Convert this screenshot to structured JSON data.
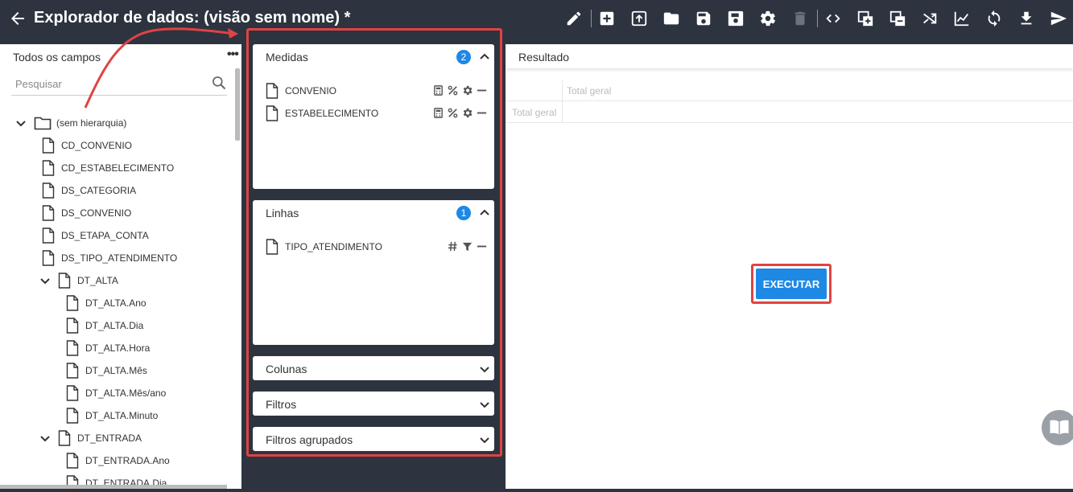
{
  "header": {
    "title": "Explorador de dados: (visão sem nome) *"
  },
  "toolbar": [
    {
      "name": "edit-icon"
    },
    {
      "name": "add-icon"
    },
    {
      "name": "upload-icon"
    },
    {
      "name": "folder-icon"
    },
    {
      "name": "save-icon"
    },
    {
      "name": "save-as-icon"
    },
    {
      "name": "settings-icon"
    },
    {
      "name": "delete-icon"
    },
    {
      "name": "code-icon"
    },
    {
      "name": "add-copy-icon"
    },
    {
      "name": "remove-copy-icon"
    },
    {
      "name": "shuffle-icon"
    },
    {
      "name": "chart-icon"
    },
    {
      "name": "refresh-icon"
    },
    {
      "name": "download-icon"
    },
    {
      "name": "send-icon"
    }
  ],
  "fields_panel": {
    "title": "Todos os campos",
    "more": "•••",
    "search_placeholder": "Pesquisar",
    "tree": [
      {
        "label": "(sem hierarquia)",
        "type": "folder"
      },
      {
        "label": "CD_CONVENIO",
        "type": "file"
      },
      {
        "label": "CD_ESTABELECIMENTO",
        "type": "file"
      },
      {
        "label": "DS_CATEGORIA",
        "type": "file"
      },
      {
        "label": "DS_CONVENIO",
        "type": "file"
      },
      {
        "label": "DS_ETAPA_CONTA",
        "type": "file"
      },
      {
        "label": "DS_TIPO_ATENDIMENTO",
        "type": "file"
      },
      {
        "label": "DT_ALTA",
        "type": "group"
      },
      {
        "label": "DT_ALTA.Ano",
        "type": "file"
      },
      {
        "label": "DT_ALTA.Dia",
        "type": "file"
      },
      {
        "label": "DT_ALTA.Hora",
        "type": "file"
      },
      {
        "label": "DT_ALTA.Mês",
        "type": "file"
      },
      {
        "label": "DT_ALTA.Mês/ano",
        "type": "file"
      },
      {
        "label": "DT_ALTA.Minuto",
        "type": "file"
      },
      {
        "label": "DT_ENTRADA",
        "type": "group"
      },
      {
        "label": "DT_ENTRADA.Ano",
        "type": "file"
      },
      {
        "label": "DT_ENTRADA.Dia",
        "type": "file"
      }
    ]
  },
  "config": {
    "medidas": {
      "title": "Medidas",
      "count": "2",
      "fields": [
        "CONVENIO",
        "ESTABELECIMENTO"
      ]
    },
    "linhas": {
      "title": "Linhas",
      "count": "1",
      "fields": [
        "TIPO_ATENDIMENTO"
      ]
    },
    "colunas": {
      "title": "Colunas"
    },
    "filtros": {
      "title": "Filtros"
    },
    "filtros_agrupados": {
      "title": "Filtros agrupados"
    }
  },
  "result": {
    "title": "Resultado",
    "grand_total_col": "Total geral",
    "grand_total_row": "Total geral",
    "run_label": "EXECUTAR"
  },
  "colors": {
    "accent": "#1e88e5",
    "highlight": "#e04343",
    "dark": "#2d3440"
  }
}
